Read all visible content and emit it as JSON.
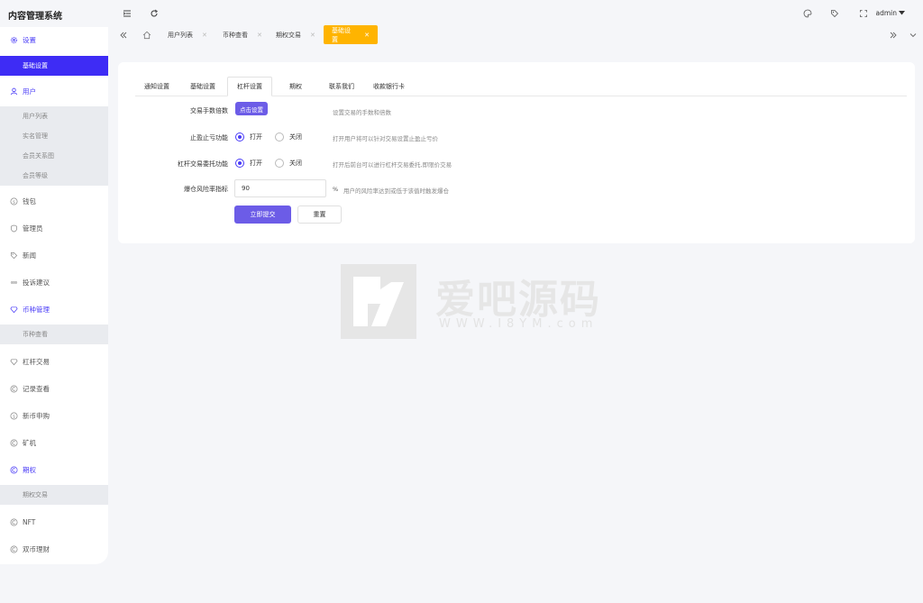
{
  "app": {
    "title": "内容管理系统"
  },
  "sidebar": {
    "items": [
      {
        "label": "设置",
        "icon": "gear-icon"
      },
      {
        "label": "用户",
        "icon": "user-icon"
      },
      {
        "label": "钱包",
        "icon": "coin-icon"
      },
      {
        "label": "管理员",
        "icon": "shield-icon"
      },
      {
        "label": "新闻",
        "icon": "tag-icon"
      },
      {
        "label": "投诉建议",
        "icon": "chat-icon"
      },
      {
        "label": "币种管理",
        "icon": "diamond-icon"
      },
      {
        "label": "杠杆交易",
        "icon": "diamond-icon"
      },
      {
        "label": "记录查看",
        "icon": "copyright-icon"
      },
      {
        "label": "新币申购",
        "icon": "coin-icon"
      },
      {
        "label": "矿机",
        "icon": "copyright-icon"
      },
      {
        "label": "期权",
        "icon": "copyright-icon"
      },
      {
        "label": "NFT",
        "icon": "copyright-icon"
      },
      {
        "label": "双币理财",
        "icon": "copyright-icon"
      }
    ],
    "subitems": {
      "settings": [
        "基础设置"
      ],
      "users": [
        "用户列表",
        "实名管理",
        "会员关系图",
        "会员等级"
      ],
      "currency": [
        "币种查看"
      ],
      "options": [
        "期权交易"
      ]
    }
  },
  "topbar": {
    "user": "admin",
    "icons": [
      "menu-fold-icon",
      "refresh-icon",
      "palette-icon",
      "tag-icon",
      "fullscreen-icon"
    ]
  },
  "tabs": {
    "items": [
      {
        "label": "用户列表"
      },
      {
        "label": "币种查看"
      },
      {
        "label": "期权交易"
      },
      {
        "label": "基础设置"
      }
    ]
  },
  "panel": {
    "tabs": [
      "通知设置",
      "基础设置",
      "杠杆设置",
      "期权",
      "联系我们",
      "收款银行卡"
    ],
    "active_tab": "杠杆设置",
    "form": {
      "fee": {
        "label": "交易手数倍数",
        "button": "点击设置",
        "hint": "设置交易的手数和倍数"
      },
      "tpsl": {
        "label": "止盈止亏功能",
        "on": "打开",
        "off": "关闭",
        "hint": "打开用户将可以针对交易设置止盈止亏价"
      },
      "entrust": {
        "label": "杠杆交易委托功能",
        "on": "打开",
        "off": "关闭",
        "hint": "打开后前台可以进行杠杆交易委托,即限价交易"
      },
      "liquidation": {
        "label": "爆仓风险率指标",
        "value": "90",
        "unit": "%",
        "hint": "用户的风险率达到或低于该值时触发爆仓"
      },
      "submit": "立即提交",
      "reset": "重置"
    }
  },
  "watermark": {
    "text": "爱吧源码",
    "url": "WWW.I8YM.com"
  },
  "colors": {
    "accent": "#4a3cf7",
    "tab_active": "#ffb400",
    "button": "#6c5ce7"
  }
}
